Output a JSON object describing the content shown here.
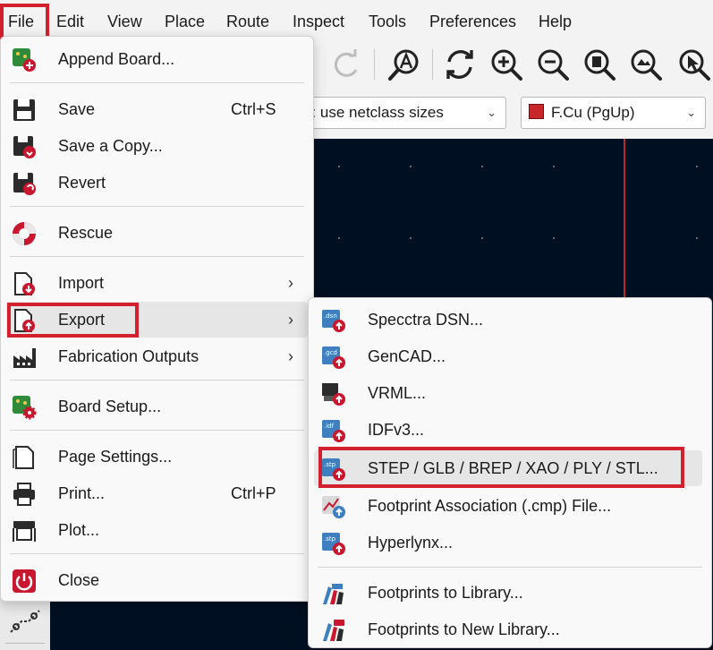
{
  "menubar": {
    "items": [
      "File",
      "Edit",
      "View",
      "Place",
      "Route",
      "Inspect",
      "Tools",
      "Preferences",
      "Help"
    ]
  },
  "toolbar2": {
    "size_combo": "a: use netclass sizes",
    "layer_combo": "F.Cu (PgUp)"
  },
  "file_menu": {
    "append_board": "Append Board...",
    "save": "Save",
    "save_shortcut": "Ctrl+S",
    "save_copy": "Save a Copy...",
    "revert": "Revert",
    "rescue": "Rescue",
    "import": "Import",
    "export": "Export",
    "fabrication": "Fabrication Outputs",
    "board_setup": "Board Setup...",
    "page_settings": "Page Settings...",
    "print": "Print...",
    "print_shortcut": "Ctrl+P",
    "plot": "Plot...",
    "close": "Close"
  },
  "export_menu": {
    "specctra": "Specctra DSN...",
    "gencad": "GenCAD...",
    "vrml": "VRML...",
    "idf": "IDFv3...",
    "step": "STEP / GLB / BREP / XAO / PLY / STL...",
    "footprint_assoc": "Footprint Association (.cmp) File...",
    "hyperlynx": "Hyperlynx...",
    "fp_to_lib": "Footprints to Library...",
    "fp_to_new_lib": "Footprints to New Library..."
  },
  "icon_badges": {
    "dsn": ".dsn",
    "gcd": ".gcd",
    "idf": ".idf",
    "stp": ".stp"
  },
  "colors": {
    "highlight_red": "#d2202f",
    "canvas": "#001023",
    "export_arrow": "#c8172e",
    "layer_swatch": "#c8262b"
  }
}
